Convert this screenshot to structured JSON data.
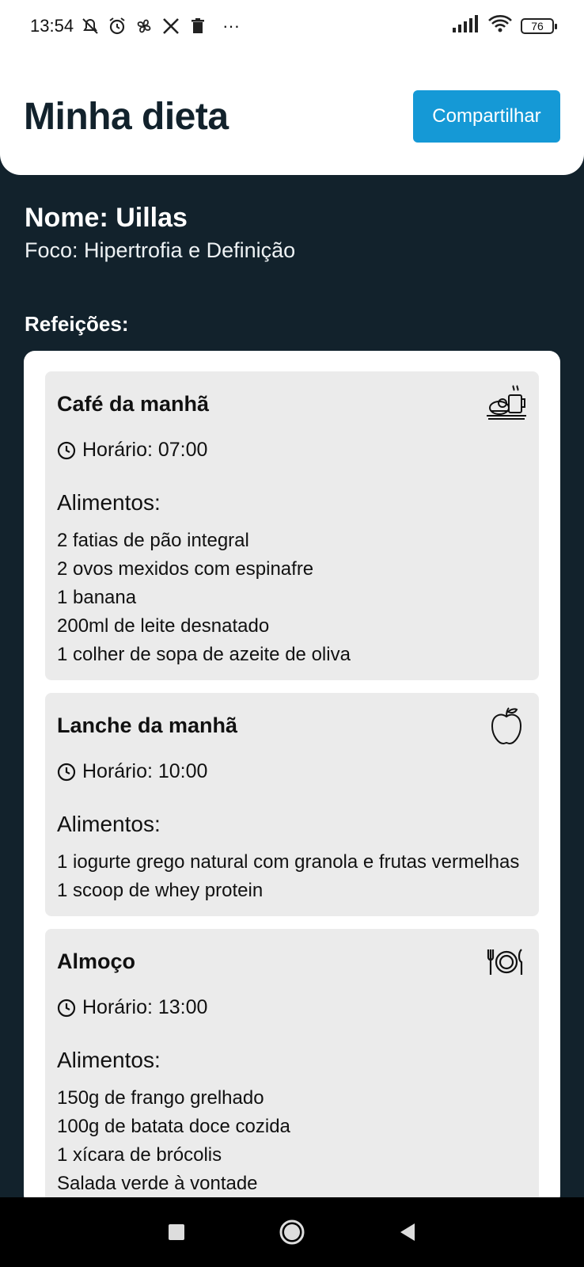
{
  "status_bar": {
    "time": "13:54",
    "left_icons": [
      "mute-icon",
      "alarm-icon",
      "fan-icon",
      "x-app-icon",
      "trash-icon",
      "more-dots-icon"
    ],
    "more": "···",
    "battery": "76"
  },
  "header": {
    "title": "Minha dieta",
    "share_label": "Compartilhar",
    "accent": "#1599d6"
  },
  "profile": {
    "name": "Nome: Uillas",
    "focus": "Foco: Hipertrofia e Definição"
  },
  "meals_title": "Refeições:",
  "meals": [
    {
      "name": "Café da manhã",
      "icon": "breakfast-icon",
      "time": "Horário: 07:00",
      "foods_title": "Alimentos:",
      "foods": [
        "2 fatias de pão integral",
        "2 ovos mexidos com espinafre",
        "1 banana",
        "200ml de leite desnatado",
        "1 colher de sopa de azeite de oliva"
      ]
    },
    {
      "name": "Lanche da manhã",
      "icon": "apple-icon",
      "time": "Horário: 10:00",
      "foods_title": "Alimentos:",
      "foods": [
        "1 iogurte grego natural com granola e frutas vermelhas",
        "1 scoop de whey protein"
      ]
    },
    {
      "name": "Almoço",
      "icon": "plate-cutlery-icon",
      "time": "Horário: 13:00",
      "foods_title": "Alimentos:",
      "foods": [
        "150g de frango grelhado",
        "100g de batata doce cozida",
        "1 xícara de brócolis",
        "Salada verde à vontade"
      ]
    }
  ],
  "colors": {
    "background": "#12222c",
    "card": "#ebebeb",
    "title": "#12222c"
  }
}
